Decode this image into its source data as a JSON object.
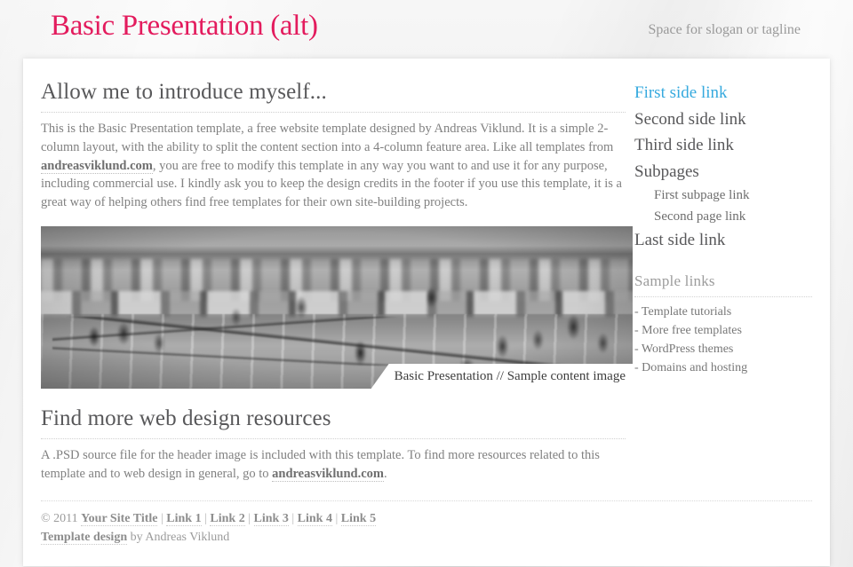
{
  "header": {
    "site_title": "Basic Presentation (alt)",
    "slogan": "Space for slogan or tagline",
    "title_color": "#e31b5d"
  },
  "content": {
    "heading_1": "Allow me to introduce myself...",
    "paragraph_1_a": "This is the Basic Presentation template, a free website template designed by Andreas Viklund. It is a simple 2-column layout, with the ability to split the content section into a 4-column feature area. Like all templates from ",
    "paragraph_1_link": "andreasviklund.com",
    "paragraph_1_b": ", you are free to modify this template in any way you want to and use it for any purpose, including commercial use. I kindly ask you to keep the design credits in the footer if you use this template, it is a great way of helping others find free templates for their own site-building projects.",
    "figure_caption": "Basic Presentation // Sample content image",
    "heading_2": "Find more web design resources",
    "paragraph_2_a": "A .PSD source file for the header image is included with this template. To find more resources related to this template and to web design in general, go to ",
    "paragraph_2_link": "andreasviklund.com",
    "paragraph_2_b": "."
  },
  "sidebar": {
    "nav": [
      {
        "label": "First side link",
        "active": true,
        "sub": false
      },
      {
        "label": "Second side link",
        "active": false,
        "sub": false
      },
      {
        "label": "Third side link",
        "active": false,
        "sub": false
      },
      {
        "label": "Subpages",
        "active": false,
        "sub": false
      },
      {
        "label": "First subpage link",
        "active": false,
        "sub": true
      },
      {
        "label": "Second page link",
        "active": false,
        "sub": true
      },
      {
        "label": "Last side link",
        "active": false,
        "sub": false
      }
    ],
    "active_color": "#35a9de",
    "section_heading": "Sample links",
    "sample_links": [
      "- Template tutorials",
      "- More free templates",
      "- WordPress themes",
      "- Domains and hosting"
    ]
  },
  "footer": {
    "copyright": "© 2011 ",
    "site_title_link": "Your Site Title",
    "links": [
      "Link 1",
      "Link 2",
      "Link 3",
      "Link 4",
      "Link 5"
    ],
    "separator": " | ",
    "credit_link": "Template design",
    "credit_mid": " by ",
    "credit_author": "Andreas Viklund"
  }
}
